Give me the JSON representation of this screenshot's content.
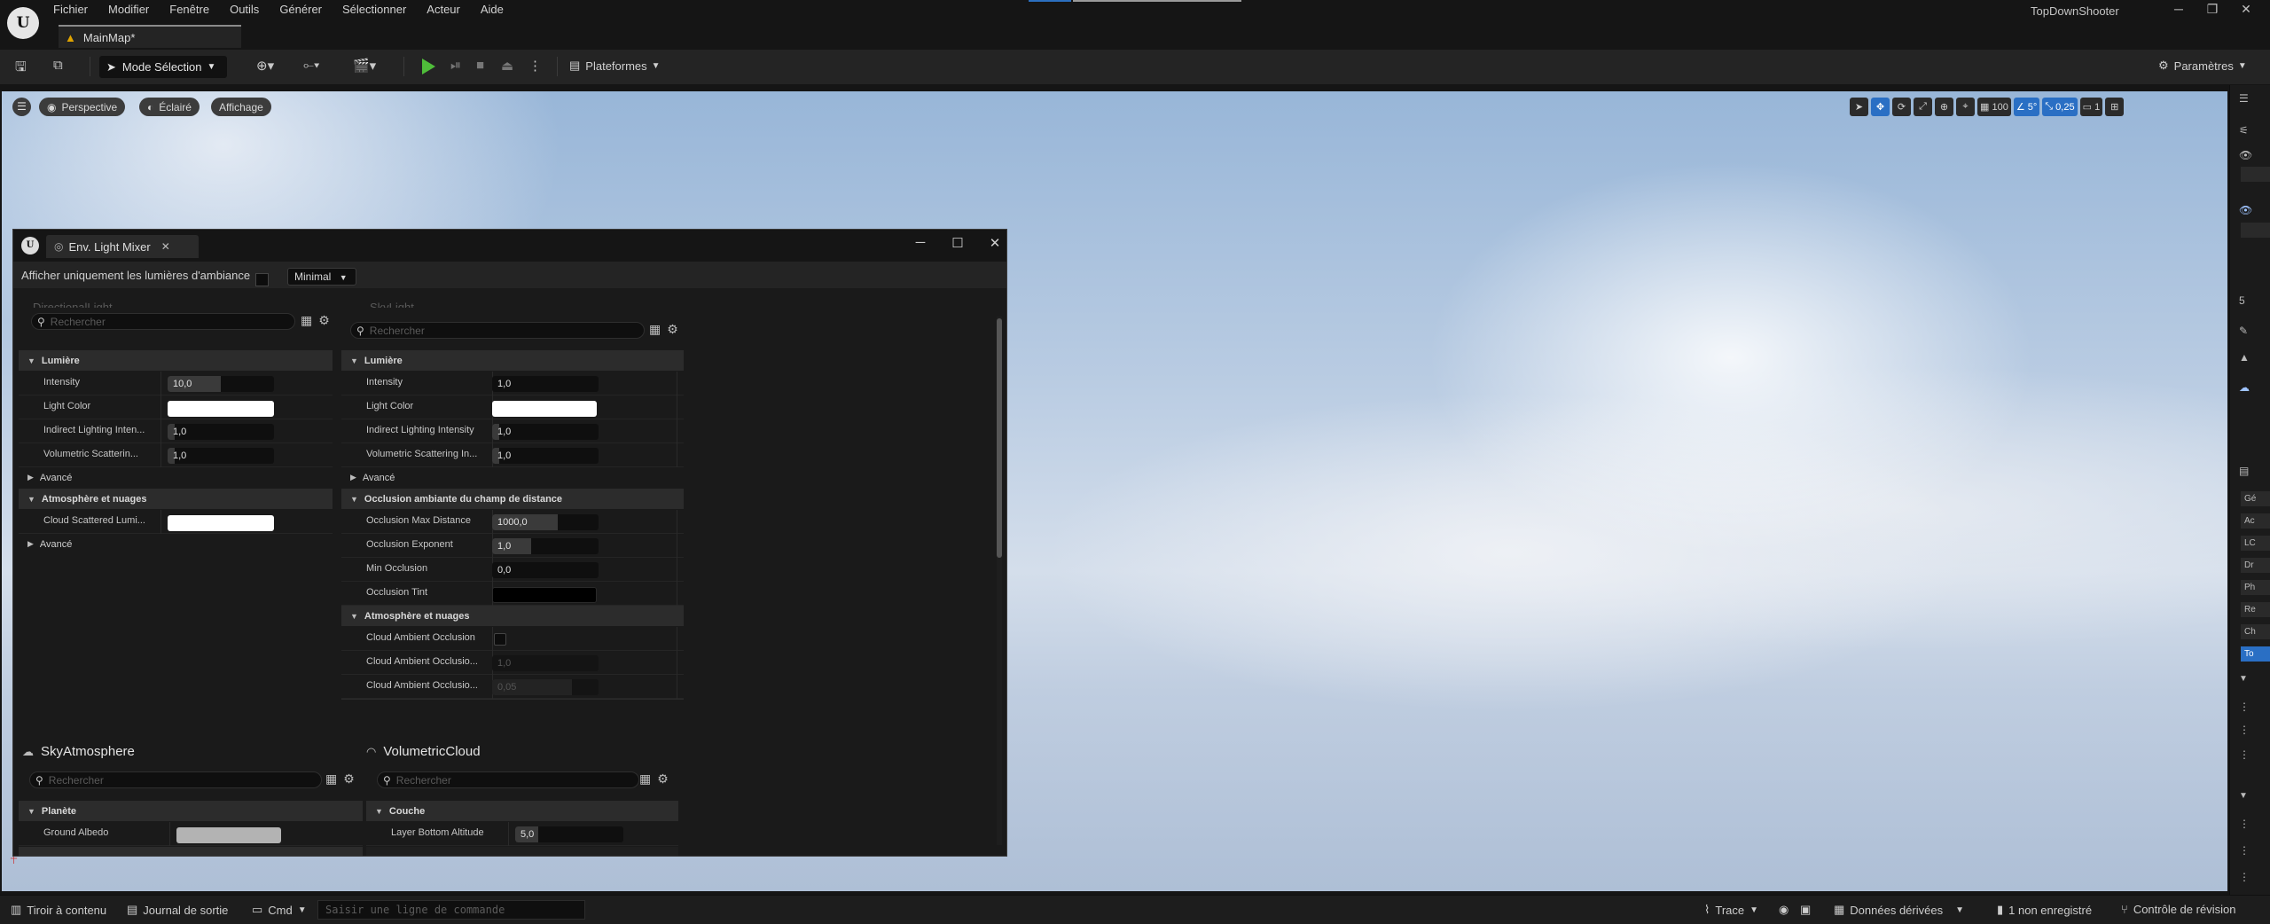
{
  "menu": [
    "Fichier",
    "Modifier",
    "Fenêtre",
    "Outils",
    "Générer",
    "Sélectionner",
    "Acteur",
    "Aide"
  ],
  "doc_tab": "MainMap*",
  "project_name": "TopDownShooter",
  "toolbar": {
    "mode": "Mode Sélection",
    "platforms": "Plateformes",
    "settings": "Paramètres"
  },
  "viewport": {
    "perspective": "Perspective",
    "lit": "Éclairé",
    "show": "Affichage",
    "grid_size": "100",
    "rotation_snap": "5°",
    "scale_snap": "0,25",
    "camera_speed": "1"
  },
  "right_strip": {
    "number": "5",
    "rows": [
      "Gé",
      "Ac",
      "LC",
      "Dr",
      "Ph",
      "Re",
      "Ch",
      "To"
    ]
  },
  "mixer": {
    "tab_title": "Env. Light Mixer",
    "ambient_only_label": "Afficher uniquement les lumières d'ambiance",
    "detail_level": "Minimal",
    "search_placeholder": "Rechercher",
    "left": {
      "header_cut": "DirectionalLight",
      "cat_light": "Lumière",
      "props": [
        {
          "label": "Intensity",
          "value": "10,0"
        },
        {
          "label": "Light Color",
          "value": ""
        },
        {
          "label": "Indirect Lighting Inten...",
          "value": "1,0"
        },
        {
          "label": "Volumetric Scatterin...",
          "value": "1,0"
        }
      ],
      "advanced1": "Avancé",
      "cat_atmo": "Atmosphère et nuages",
      "cloud_label": "Cloud Scattered Lumi...",
      "advanced2": "Avancé"
    },
    "right": {
      "header_cut": "SkyLight",
      "cat_light": "Lumière",
      "props": [
        {
          "label": "Intensity",
          "value": "1,0"
        },
        {
          "label": "Light Color",
          "value": ""
        },
        {
          "label": "Indirect Lighting Intensity",
          "value": "1,0"
        },
        {
          "label": "Volumetric Scattering In...",
          "value": "1,0"
        }
      ],
      "advanced": "Avancé",
      "cat_ao": "Occlusion ambiante du champ de distance",
      "ao_props": [
        {
          "label": "Occlusion Max Distance",
          "value": "1000,0"
        },
        {
          "label": "Occlusion Exponent",
          "value": "1,0"
        },
        {
          "label": "Min Occlusion",
          "value": "0,0"
        },
        {
          "label": "Occlusion Tint",
          "value": ""
        }
      ],
      "cat_atmo": "Atmosphère et nuages",
      "atmo_props": [
        {
          "label": "Cloud Ambient Occlusion",
          "value": ""
        },
        {
          "label": "Cloud Ambient Occlusio...",
          "value": "1,0"
        },
        {
          "label": "Cloud Ambient Occlusio...",
          "value": "0,05"
        }
      ]
    },
    "sky_atmosphere": {
      "title": "SkyAtmosphere",
      "cat": "Planète",
      "prop": "Ground Albedo"
    },
    "volumetric_cloud": {
      "title": "VolumetricCloud",
      "cat": "Couche",
      "prop": "Layer Bottom Altitude",
      "value": "5,0"
    }
  },
  "statusbar": {
    "content_drawer": "Tiroir à contenu",
    "output_log": "Journal de sortie",
    "cmd": "Cmd",
    "cmd_placeholder": "Saisir une ligne de commande",
    "trace": "Trace",
    "derived_data": "Données dérivées",
    "unsaved": "1 non enregistré",
    "revision_control": "Contrôle de révision"
  },
  "colors": {
    "accent": "#2a6fc4",
    "play": "#4fbd3a",
    "map_icon": "#e0a400",
    "light_color": "#ffffff",
    "occlusion_tint": "#000000",
    "ground_albedo": "#b3b3b3"
  }
}
